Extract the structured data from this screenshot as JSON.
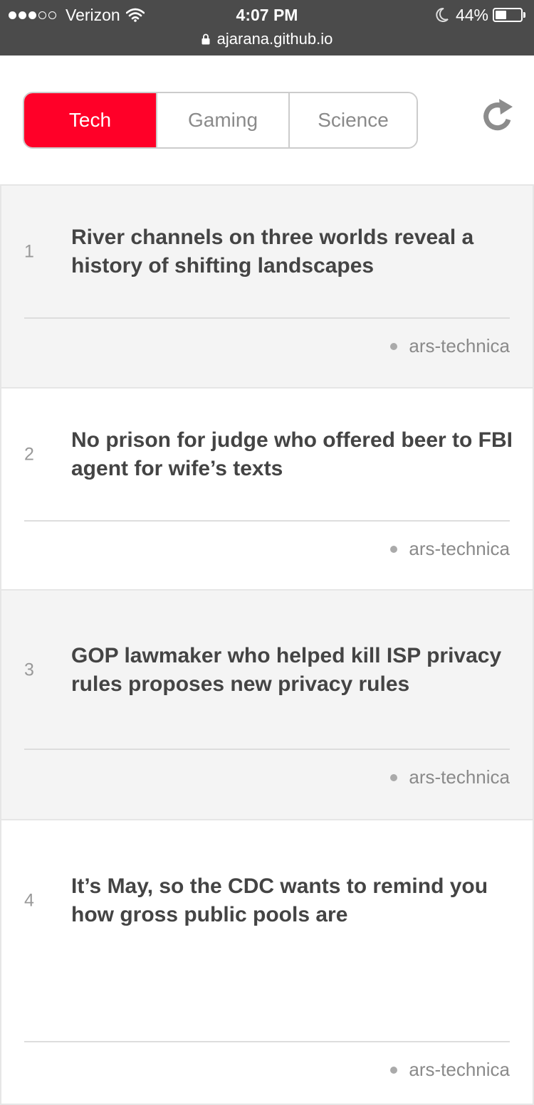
{
  "status_bar": {
    "signal_full": 3,
    "signal_empty": 2,
    "carrier": "Verizon",
    "time": "4:07 PM",
    "battery_percent": "44%",
    "battery_level": 0.44,
    "icons": [
      "wifi-icon",
      "moon-icon",
      "battery-icon"
    ]
  },
  "url_bar": {
    "domain": "ajarana.github.io",
    "icon": "lock-icon"
  },
  "header": {
    "tabs": [
      {
        "label": "Tech",
        "active": true
      },
      {
        "label": "Gaming",
        "active": false
      },
      {
        "label": "Science",
        "active": false
      }
    ],
    "refresh_icon": "refresh-icon"
  },
  "colors": {
    "accent": "#ff0028",
    "status_bar_bg": "#4b4b4b",
    "odd_card_bg": "#f4f4f4",
    "headline_text": "#444444",
    "muted_text": "#8a8a8a"
  },
  "feed": {
    "items": [
      {
        "rank": "1",
        "title": "River channels on three worlds reveal a history of shifting landscapes",
        "source": "ars-technica"
      },
      {
        "rank": "2",
        "title": "No prison for judge who offered beer to FBI agent for wife’s texts",
        "source": "ars-technica"
      },
      {
        "rank": "3",
        "title": "GOP lawmaker who helped kill ISP privacy rules proposes new privacy rules",
        "source": "ars-technica"
      },
      {
        "rank": "4",
        "title": "It’s May, so the CDC wants to remind you how gross public pools are",
        "source": "ars-technica"
      }
    ]
  }
}
